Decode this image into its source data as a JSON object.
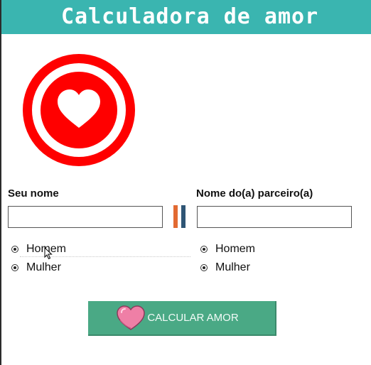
{
  "header": {
    "title": "Calculadora de amor"
  },
  "colors": {
    "header_bg": "#3ab5b0",
    "logo_red": "#ff0000",
    "button_bg": "#4aa985",
    "sep_orange": "#e26a32",
    "sep_blue": "#2f5575"
  },
  "icons": {
    "logo": "heart-circle-icon",
    "button": "heart-icon"
  },
  "form": {
    "left": {
      "label": "Seu nome",
      "value": "",
      "options": [
        "Homem",
        "Mulher"
      ]
    },
    "right": {
      "label": "Nome do(a) parceiro(a)",
      "value": "",
      "options": [
        "Homem",
        "Mulher"
      ]
    }
  },
  "button": {
    "label": "CALCULAR AMOR"
  }
}
